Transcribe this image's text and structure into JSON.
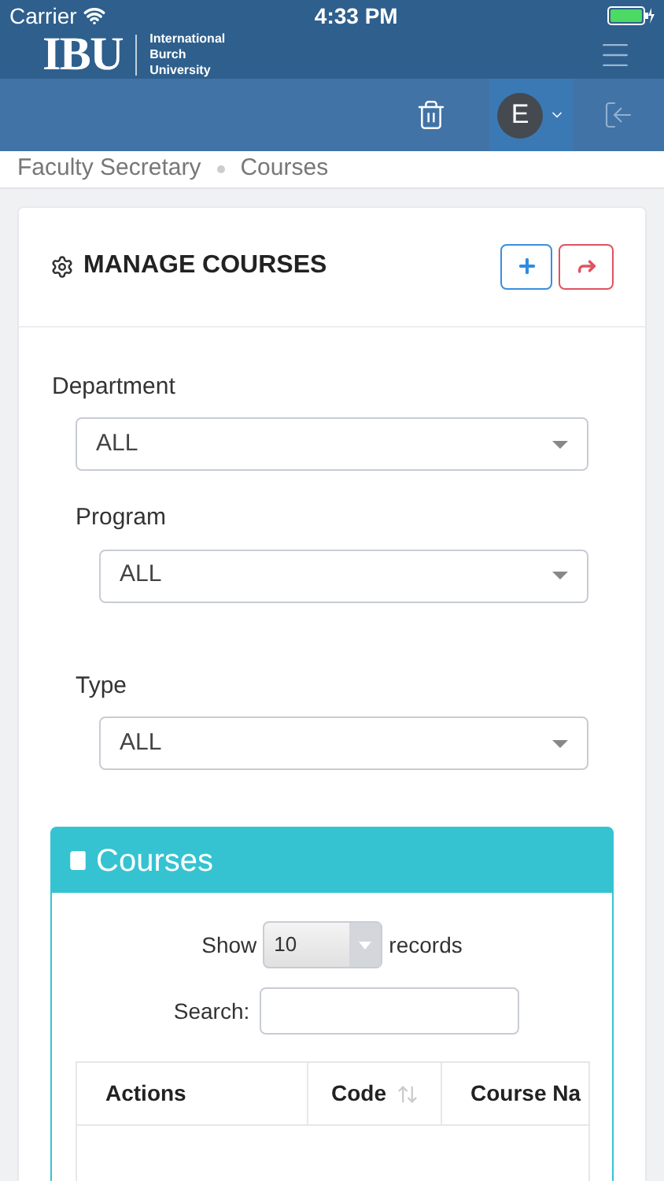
{
  "status_bar": {
    "carrier": "Carrier",
    "time": "4:33 PM"
  },
  "header": {
    "logo": "IBU",
    "logo_lines": [
      "International",
      "Burch",
      "University"
    ]
  },
  "user": {
    "initial": "E"
  },
  "breadcrumb": [
    "Faculty Secretary",
    "Courses"
  ],
  "card": {
    "title": "MANAGE COURSES",
    "filters": [
      {
        "label": "Department",
        "value": "ALL"
      },
      {
        "label": "Program",
        "value": "ALL"
      },
      {
        "label": "Type",
        "value": "ALL"
      }
    ]
  },
  "courses": {
    "title": "Courses",
    "show_label": "Show",
    "page_size": "10",
    "records_label": "records",
    "search_label": "Search:",
    "columns": [
      {
        "label": "Actions",
        "sortable": false
      },
      {
        "label": "Code",
        "sortable": true
      },
      {
        "label": "Course Na",
        "sortable": false
      }
    ]
  }
}
